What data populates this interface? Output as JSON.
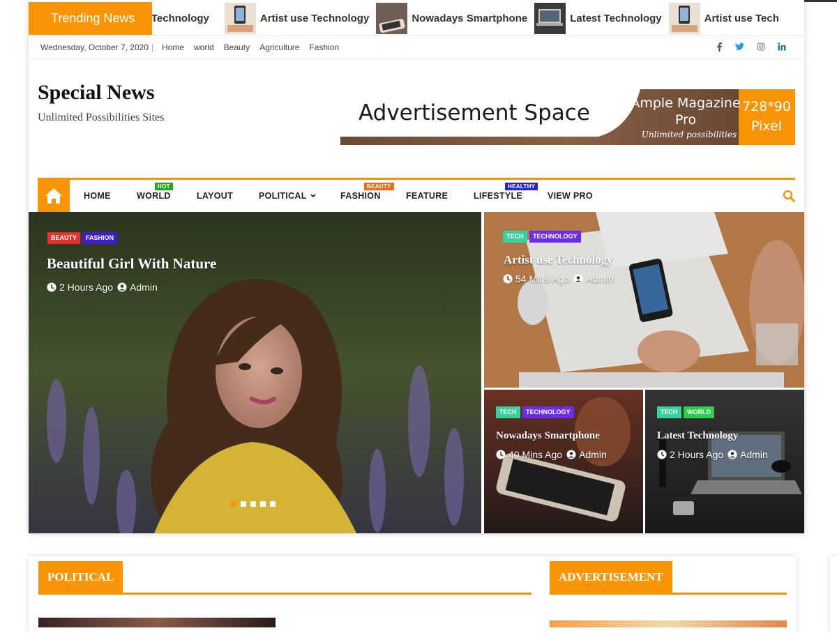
{
  "ticker": {
    "label": "Trending News",
    "items": [
      {
        "title": "est Technology"
      },
      {
        "title": "Artist use Technology"
      },
      {
        "title": "Nowadays Smartphone"
      },
      {
        "title": "Latest Technology"
      },
      {
        "title": "Artist use Tech"
      }
    ]
  },
  "topbar": {
    "date": "Wednesday, October 7, 2020",
    "separator": "|",
    "links": [
      "Home",
      "world",
      "Beauty",
      "Agriculture",
      "Fashion"
    ],
    "social": [
      "facebook-icon",
      "twitter-icon",
      "instagram-icon",
      "linkedin-icon"
    ]
  },
  "header": {
    "title": "Special News",
    "tagline": "Unlimited Possibilities Sites",
    "ad": {
      "text": "Advertisement Space",
      "brand_line1": "Ample Magazine",
      "brand_line2": "Pro",
      "brand_sub": "Unlimited possibilities",
      "size_line1": "728*90",
      "size_line2": "Pixel"
    }
  },
  "nav": {
    "items": [
      {
        "label": "HOME",
        "badge": ""
      },
      {
        "label": "WORLD",
        "badge": "HOT"
      },
      {
        "label": "LAYOUT",
        "badge": ""
      },
      {
        "label": "POLITICAL",
        "badge": ""
      },
      {
        "label": "FASHION",
        "badge": "BEAUTY"
      },
      {
        "label": "FEATURE",
        "badge": ""
      },
      {
        "label": "LIFESTYLE",
        "badge": "HEALTHY"
      },
      {
        "label": "VIEW PRO",
        "badge": ""
      }
    ],
    "colors": {
      "hot": "#23a823",
      "beauty": "#f06a1a",
      "healthy": "#2424e0"
    }
  },
  "hero": {
    "main": {
      "cats": [
        "BEAUTY",
        "FASHION"
      ],
      "title": "Beautiful Girl With Nature",
      "time": "2 Hours Ago",
      "author": "Admin"
    },
    "top_right": {
      "cats": [
        "TECH",
        "TECHNOLOGY"
      ],
      "title": "Artist use Technology",
      "time": "54 Mins Ago",
      "author": "Admin"
    },
    "bottom_left": {
      "cats": [
        "TECH",
        "TECHNOLOGY"
      ],
      "title": "Nowadays Smartphone",
      "time": "40 Mins Ago",
      "author": "Admin"
    },
    "bottom_right": {
      "cats": [
        "TECH",
        "WORLD"
      ],
      "title": "Latest Technology",
      "time": "2 Hours Ago",
      "author": "Admin"
    },
    "slides": 5,
    "active_slide": 1
  },
  "sections": {
    "political": "POLITICAL",
    "advertisement": "ADVERTISEMENT"
  },
  "colors": {
    "accent": "#f89406",
    "beauty": "#e8302f",
    "fashion": "#3a1ec8",
    "tech": "#34d39b",
    "technology": "#6a2cf0",
    "world": "#2bd04a"
  }
}
